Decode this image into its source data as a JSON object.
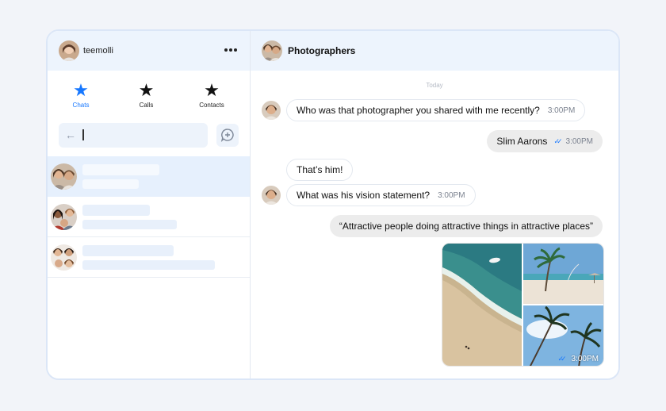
{
  "user": {
    "name": "teemolli",
    "avatar": "user-avatar"
  },
  "menu_icon": "more-horizontal-icon",
  "tabs": [
    {
      "label": "Chats",
      "icon": "star-icon",
      "active": true
    },
    {
      "label": "Calls",
      "icon": "star-icon",
      "active": false
    },
    {
      "label": "Contacts",
      "icon": "star-icon",
      "active": false
    }
  ],
  "search": {
    "value": "",
    "back_icon": "arrow-left-icon",
    "compose_icon": "new-chat-icon"
  },
  "chat_list": [
    {
      "avatar": "group-avatar",
      "selected": true
    },
    {
      "avatar": "group-avatar",
      "selected": false
    },
    {
      "avatar": "group-avatar",
      "selected": false
    }
  ],
  "conversation": {
    "title": "Photographers",
    "date_separator": "Today",
    "messages": [
      {
        "direction": "in",
        "text": "Who was that photographer you shared with me recently?",
        "time": "3:00PM"
      },
      {
        "direction": "out",
        "text": "Slim Aarons",
        "time": "3:00PM",
        "read": true
      },
      {
        "direction": "in",
        "text": "That’s him!",
        "time": ""
      },
      {
        "direction": "in",
        "text": "What was his vision statement?",
        "time": "3:00PM"
      },
      {
        "direction": "out",
        "text": "“Attractive people doing attractive things in attractive places”",
        "time": ""
      },
      {
        "direction": "out",
        "type": "images",
        "images": [
          "beach-aerial-photo",
          "palm-beach-photo",
          "palm-sky-photo"
        ],
        "time": "3:00PM",
        "read": true
      }
    ]
  },
  "colors": {
    "accent": "#1677ff",
    "header_bg": "#edf4fd",
    "selected_bg": "#e6f0fd",
    "page_bg": "#f2f4f9"
  }
}
